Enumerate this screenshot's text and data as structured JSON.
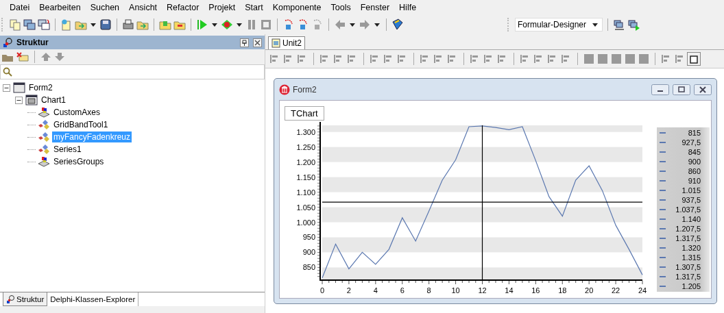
{
  "menu": [
    "Datei",
    "Bearbeiten",
    "Suchen",
    "Ansicht",
    "Refactor",
    "Projekt",
    "Start",
    "Komponente",
    "Tools",
    "Fenster",
    "Hilfe"
  ],
  "toolbar": {
    "view_combo": "Formular-Designer"
  },
  "structure_panel": {
    "title": "Struktur",
    "tree": [
      {
        "label": "Form2",
        "kind": "form",
        "expanded": true,
        "selected": false,
        "children": [
          {
            "label": "Chart1",
            "kind": "chart",
            "expanded": true,
            "selected": false,
            "children": [
              {
                "label": "CustomAxes",
                "kind": "component",
                "selected": false
              },
              {
                "label": "GridBandTool1",
                "kind": "tool",
                "selected": false
              },
              {
                "label": "myFancyFadenkreuz",
                "kind": "tool",
                "selected": true
              },
              {
                "label": "Series1",
                "kind": "tool",
                "selected": false
              },
              {
                "label": "SeriesGroups",
                "kind": "component",
                "selected": false
              }
            ]
          }
        ]
      }
    ],
    "bottom_tabs": [
      {
        "label": "Struktur",
        "selected": true
      },
      {
        "label": "Delphi-Klassen-Explorer",
        "selected": false
      }
    ]
  },
  "editor": {
    "tabs": [
      {
        "label": "Unit2",
        "selected": true
      }
    ],
    "form_window": {
      "title": "Form2",
      "chart_title": "TChart",
      "chart_data": {
        "type": "line",
        "x": [
          0,
          1,
          2,
          3,
          4,
          5,
          6,
          7,
          8,
          9,
          10,
          11,
          12,
          13,
          14,
          15,
          16,
          17,
          18,
          19,
          20,
          21,
          22,
          23,
          24
        ],
        "series": [
          {
            "color": "#5b78b0",
            "values": [
              815,
              927.5,
              845,
              900,
              860,
              910,
              1015,
              937.5,
              1037.5,
              1140,
              1207.5,
              1317.5,
              1320,
              1315,
              1307.5,
              1317.5,
              1205,
              1085,
              1020,
              1140,
              1187.5,
              1105,
              990,
              910,
              825
            ]
          }
        ],
        "xlim": [
          0,
          24
        ],
        "ylim": [
          810,
          1322
        ],
        "xticks": [
          0,
          2,
          4,
          6,
          8,
          10,
          12,
          14,
          16,
          18,
          20,
          22,
          24
        ],
        "yticks": [
          {
            "value": 850,
            "label": "850"
          },
          {
            "value": 900,
            "label": "900"
          },
          {
            "value": 950,
            "label": "950"
          },
          {
            "value": 1000,
            "label": "1.000"
          },
          {
            "value": 1050,
            "label": "1.050"
          },
          {
            "value": 1100,
            "label": "1.100"
          },
          {
            "value": 1150,
            "label": "1.150"
          },
          {
            "value": 1200,
            "label": "1.200"
          },
          {
            "value": 1250,
            "label": "1.250"
          },
          {
            "value": 1300,
            "label": "1.300"
          }
        ]
      },
      "legend": [
        "815",
        "927,5",
        "845",
        "900",
        "860",
        "910",
        "1.015",
        "937,5",
        "1.037,5",
        "1.140",
        "1.207,5",
        "1.317,5",
        "1.320",
        "1.315",
        "1.307,5",
        "1.317,5",
        "1.205"
      ]
    }
  }
}
